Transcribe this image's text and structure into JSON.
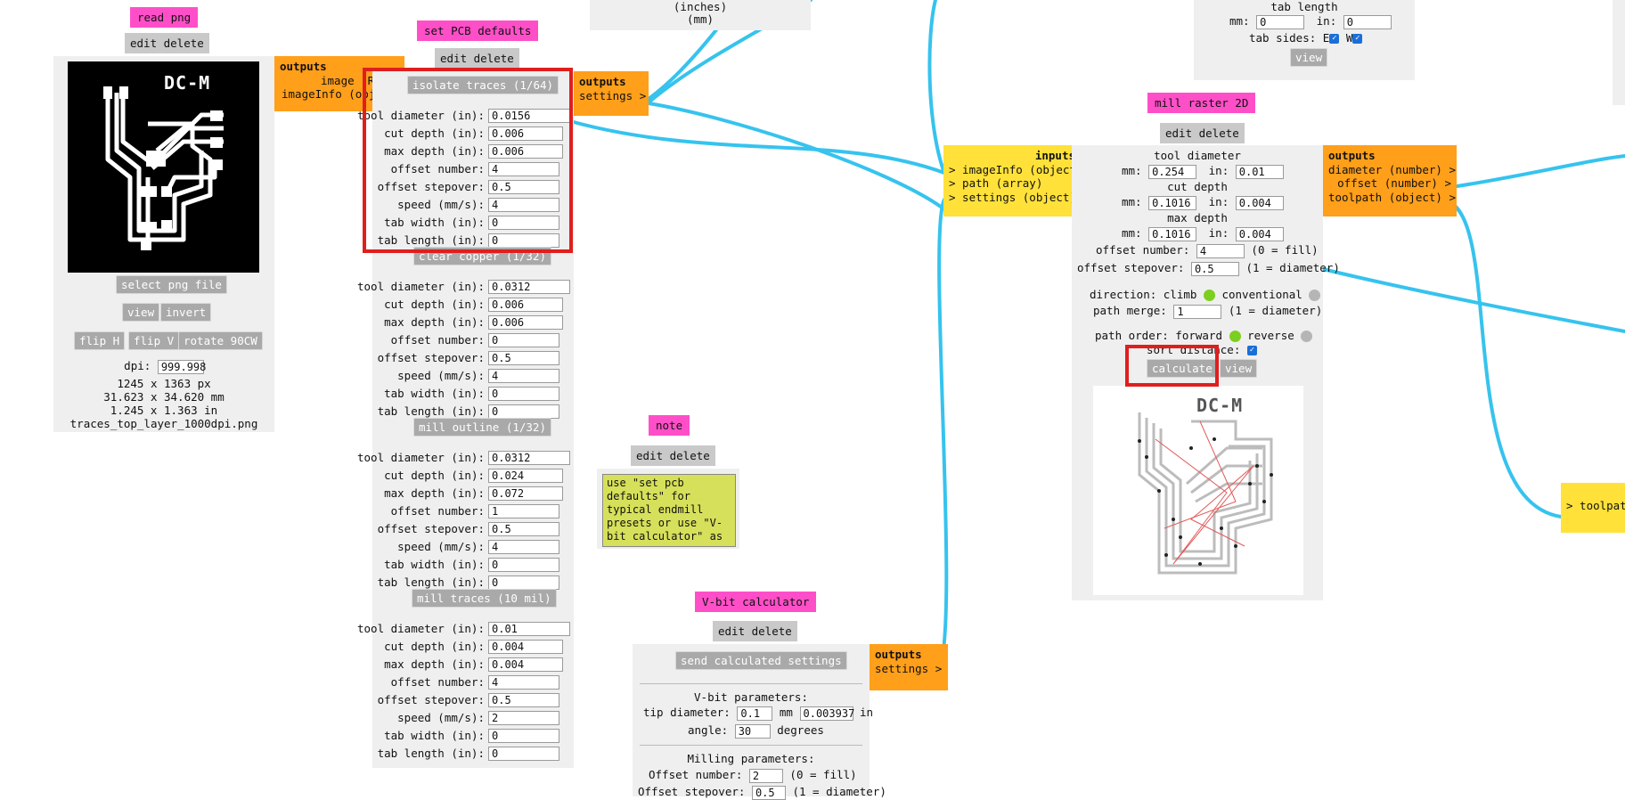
{
  "colors": {
    "wire": "#36c3ee",
    "pink": "#ff4fc8",
    "orange": "#ff9f1a",
    "yellow": "#ffe13a",
    "panel": "#efefef",
    "highlight": "#e01e1e",
    "radio_on": "#7ccf1e",
    "radio_off": "#b5b5b5"
  },
  "read_png": {
    "title": "read png",
    "edit": "edit delete",
    "image_label": "DC-M",
    "select_btn": "select png file",
    "view_btn": "view",
    "invert_btn": "invert",
    "flipH_btn": "flip H",
    "flipV_btn": "flip V",
    "rotate_btn": "rotate 90CW",
    "dpi_label": "dpi:",
    "dpi_value": "999.998",
    "px": "1245 x 1363 px",
    "mm": "31.623 x 34.620 mm",
    "inch": "1.245 x 1.363 in",
    "filename": "traces_top_layer_1000dpi.png",
    "outputs_title": "outputs",
    "out_image": "image (RG",
    "out_info": "imageInfo (obj"
  },
  "pcb": {
    "title": "set PCB defaults",
    "edit": "edit delete",
    "units": "(inches)",
    "units2": "(mm)",
    "outputs_title": "outputs",
    "out_settings": "settings >",
    "sections": [
      {
        "name": "isolate traces (1/64)",
        "tool": "0.0156",
        "cut": "0.006",
        "max": "0.006",
        "num": "4",
        "step": "0.5",
        "speed": "4",
        "tabw": "0",
        "tabl": "0"
      },
      {
        "name": "clear copper (1/32)",
        "tool": "0.0312",
        "cut": "0.006",
        "max": "0.006",
        "num": "0",
        "step": "0.5",
        "speed": "4",
        "tabw": "0",
        "tabl": "0"
      },
      {
        "name": "mill outline (1/32)",
        "tool": "0.0312",
        "cut": "0.024",
        "max": "0.072",
        "num": "1",
        "step": "0.5",
        "speed": "4",
        "tabw": "0",
        "tabl": "0"
      },
      {
        "name": "mill traces (10 mil)",
        "tool": "0.01",
        "cut": "0.004",
        "max": "0.004",
        "num": "4",
        "step": "0.5",
        "speed": "2",
        "tabw": "0",
        "tabl": "0"
      }
    ],
    "labels": {
      "tool": "tool diameter (in):",
      "cut": "cut depth (in):",
      "max": "max depth (in):",
      "num": "offset number:",
      "step": "offset stepover:",
      "speed": "speed (mm/s):",
      "tabw": "tab width (in):",
      "tabl": "tab length (in):"
    }
  },
  "note": {
    "title": "note",
    "edit": "edit delete",
    "text": "use \"set pcb defaults\" for typical endmill presets or use \"V-bit calculator\" as a"
  },
  "vbit": {
    "title": "V-bit calculator",
    "edit": "edit delete",
    "send_btn": "send calculated settings",
    "params_title": "V-bit parameters:",
    "tip_label": "tip diameter:",
    "tip_mm": "0.1",
    "mm_unit": "mm",
    "tip_in": "0.003937",
    "in_unit": "in",
    "angle_label": "angle:",
    "angle": "30",
    "deg_unit": "degrees",
    "milling_title": "Milling parameters:",
    "num_label": "Offset number:",
    "num": "2",
    "num_hint": "(0 = fill)",
    "step_label": "Offset stepover:",
    "step": "0.5",
    "step_hint": "(1 = diameter)",
    "outputs_title": "outputs",
    "out_settings": "settings >"
  },
  "mill": {
    "title": "mill raster 2D",
    "edit": "edit delete",
    "inputs_title": "inputs",
    "in1": "> imageInfo (object)",
    "in2": "> path (array)",
    "in3": "> settings (object)",
    "tool_title": "tool diameter",
    "mm_label": "mm:",
    "in_label": "in:",
    "tool_mm": "0.254",
    "tool_in": "0.01",
    "cut_title": "cut depth",
    "cut_mm": "0.1016",
    "cut_in": "0.004",
    "max_title": "max depth",
    "max_mm": "0.1016",
    "max_in": "0.004",
    "num_label": "offset number:",
    "num": "4",
    "num_hint": "(0 = fill)",
    "step_label": "offset stepover:",
    "step": "0.5",
    "step_hint": "(1 = diameter)",
    "dir_label": "direction: climb",
    "dir_alt": "conventional",
    "merge_label": "path merge:",
    "merge": "1",
    "merge_hint": "(1 = diameter)",
    "order_label": "path order: forward",
    "order_alt": "reverse",
    "sort_label": "sort distance:",
    "calc_btn": "calculate",
    "view_btn": "view",
    "preview_label": "DC-M",
    "outputs_title": "outputs",
    "out1": "diameter (number) >",
    "out2": "offset (number) >",
    "out3": "toolpath (object) >"
  },
  "tab_panel": {
    "title": "tab length",
    "mm_label": "mm:",
    "mm": "0",
    "in_label": "in:",
    "in": "0",
    "sides_label": "tab sides: E",
    "w_label": "W",
    "view_btn": "view"
  },
  "far_right": {
    "in_label": "> toolpath"
  }
}
